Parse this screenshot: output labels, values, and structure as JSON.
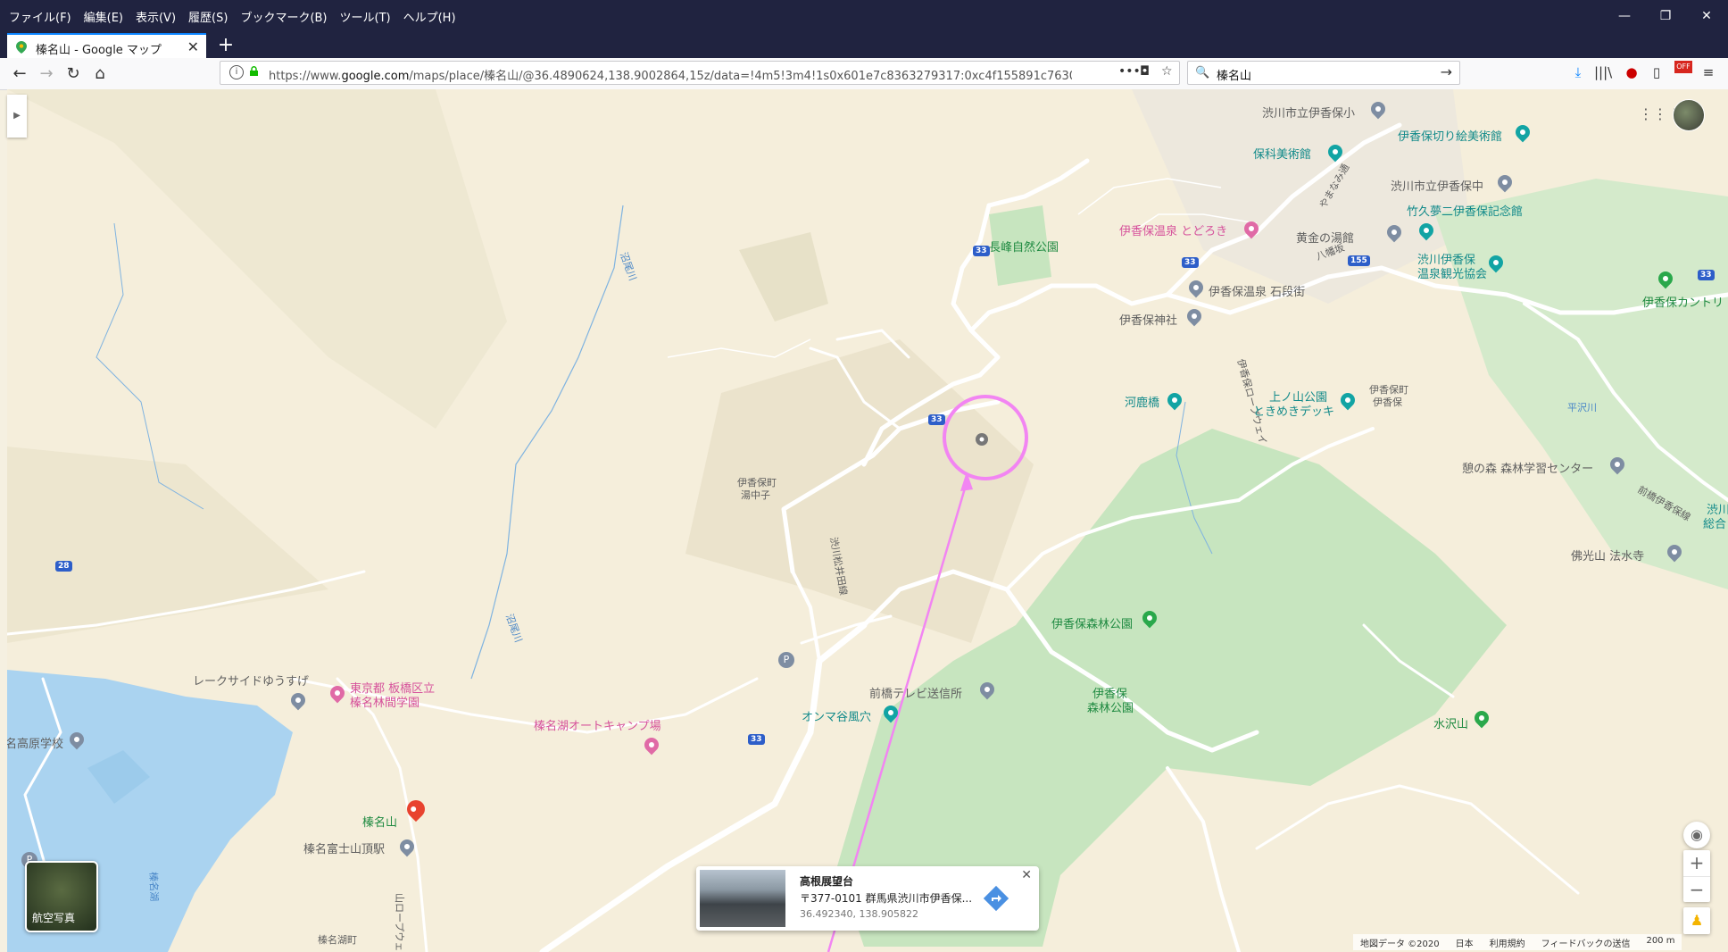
{
  "browser": {
    "menu": [
      "ファイル(F)",
      "編集(E)",
      "表示(V)",
      "履歴(S)",
      "ブックマーク(B)",
      "ツール(T)",
      "ヘルプ(H)"
    ],
    "tab_title": "榛名山 - Google マップ",
    "url_prefix": "https://www.",
    "url_domain": "google.com",
    "url_rest": "/maps/place/榛名山/@36.4890624,138.9002864,15z/data=!4m5!3m4!1s0x601e7c8363279317:0xc4f155891c763050!8m2!3d36.4",
    "search_value": "榛名山",
    "off_badge": "OFF"
  },
  "map": {
    "labels": {
      "l1": "渋川市立伊香保小",
      "l2": "伊香保切り絵美術館",
      "l3": "保科美術館",
      "l4": "渋川市立伊香保中",
      "l5": "伊香保温泉 とどろき",
      "l6": "竹久夢二伊香保記念館",
      "l7": "黄金の湯館",
      "l8": "長峰自然公園",
      "l9": "渋川伊香保",
      "l10": "温泉観光協会",
      "l11": "伊香保温泉 石段街",
      "l12": "伊香保カントリ",
      "l13": "伊香保神社",
      "l14": "伊香保ロープウェイ",
      "l15": "伊香保町",
      "l16": "伊香保",
      "l17": "河鹿橋",
      "l18": "上ノ山公園",
      "l19": "ときめきデッキ",
      "l20": "平沢川",
      "l21": "憩の森 森林学習センター",
      "l22": "伊香保町",
      "l23": "湯中子",
      "l24": "渋川松井田線",
      "l25": "沼尾川",
      "l26": "佛光山 法水寺",
      "l27": "伊香保森林公園",
      "l28": "レークサイドゆうすげ",
      "l29": "東京都 板橋区立",
      "l30": "榛名林間学園",
      "l31": "前橋テレビ送信所",
      "l32": "伊香保",
      "l33": "森林公園",
      "l34": "榛名湖オートキャンプ場",
      "l35": "オンマ谷風穴",
      "l36": "水沢山",
      "l37": "名高原学校",
      "l38": "榛名山",
      "l39": "榛名富士山頂駅",
      "l40": "榛名湖",
      "l41": "榛名湖町",
      "l42": "山ロープウェイ",
      "l43": "沼尾川",
      "l44": "前橋伊香保線",
      "l45": "渋川",
      "l46": "総合",
      "l47": "やまなみ通",
      "l48": "八幡坂"
    },
    "route_shields": [
      "33",
      "33",
      "155",
      "33",
      "33",
      "28",
      "33"
    ],
    "satellite_label": "航空写真",
    "zoom_in": "+",
    "zoom_out": "−",
    "infocard": {
      "title": "高根展望台",
      "address": "〒377-0101 群馬県渋川市伊香保...",
      "coords": "36.492340, 138.905822",
      "close": "✕"
    },
    "footer": [
      "地図データ ©2020",
      "日本",
      "利用規約",
      "フィードバックの送信",
      "200 m"
    ]
  }
}
